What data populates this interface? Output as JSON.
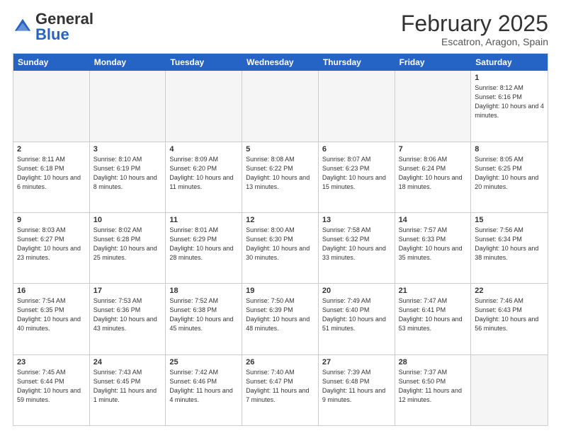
{
  "header": {
    "logo": {
      "general": "General",
      "blue": "Blue"
    },
    "month_title": "February 2025",
    "location": "Escatron, Aragon, Spain"
  },
  "calendar": {
    "days_of_week": [
      "Sunday",
      "Monday",
      "Tuesday",
      "Wednesday",
      "Thursday",
      "Friday",
      "Saturday"
    ],
    "weeks": [
      [
        {
          "day": "",
          "info": ""
        },
        {
          "day": "",
          "info": ""
        },
        {
          "day": "",
          "info": ""
        },
        {
          "day": "",
          "info": ""
        },
        {
          "day": "",
          "info": ""
        },
        {
          "day": "",
          "info": ""
        },
        {
          "day": "1",
          "info": "Sunrise: 8:12 AM\nSunset: 6:16 PM\nDaylight: 10 hours and 4 minutes."
        }
      ],
      [
        {
          "day": "2",
          "info": "Sunrise: 8:11 AM\nSunset: 6:18 PM\nDaylight: 10 hours and 6 minutes."
        },
        {
          "day": "3",
          "info": "Sunrise: 8:10 AM\nSunset: 6:19 PM\nDaylight: 10 hours and 8 minutes."
        },
        {
          "day": "4",
          "info": "Sunrise: 8:09 AM\nSunset: 6:20 PM\nDaylight: 10 hours and 11 minutes."
        },
        {
          "day": "5",
          "info": "Sunrise: 8:08 AM\nSunset: 6:22 PM\nDaylight: 10 hours and 13 minutes."
        },
        {
          "day": "6",
          "info": "Sunrise: 8:07 AM\nSunset: 6:23 PM\nDaylight: 10 hours and 15 minutes."
        },
        {
          "day": "7",
          "info": "Sunrise: 8:06 AM\nSunset: 6:24 PM\nDaylight: 10 hours and 18 minutes."
        },
        {
          "day": "8",
          "info": "Sunrise: 8:05 AM\nSunset: 6:25 PM\nDaylight: 10 hours and 20 minutes."
        }
      ],
      [
        {
          "day": "9",
          "info": "Sunrise: 8:03 AM\nSunset: 6:27 PM\nDaylight: 10 hours and 23 minutes."
        },
        {
          "day": "10",
          "info": "Sunrise: 8:02 AM\nSunset: 6:28 PM\nDaylight: 10 hours and 25 minutes."
        },
        {
          "day": "11",
          "info": "Sunrise: 8:01 AM\nSunset: 6:29 PM\nDaylight: 10 hours and 28 minutes."
        },
        {
          "day": "12",
          "info": "Sunrise: 8:00 AM\nSunset: 6:30 PM\nDaylight: 10 hours and 30 minutes."
        },
        {
          "day": "13",
          "info": "Sunrise: 7:58 AM\nSunset: 6:32 PM\nDaylight: 10 hours and 33 minutes."
        },
        {
          "day": "14",
          "info": "Sunrise: 7:57 AM\nSunset: 6:33 PM\nDaylight: 10 hours and 35 minutes."
        },
        {
          "day": "15",
          "info": "Sunrise: 7:56 AM\nSunset: 6:34 PM\nDaylight: 10 hours and 38 minutes."
        }
      ],
      [
        {
          "day": "16",
          "info": "Sunrise: 7:54 AM\nSunset: 6:35 PM\nDaylight: 10 hours and 40 minutes."
        },
        {
          "day": "17",
          "info": "Sunrise: 7:53 AM\nSunset: 6:36 PM\nDaylight: 10 hours and 43 minutes."
        },
        {
          "day": "18",
          "info": "Sunrise: 7:52 AM\nSunset: 6:38 PM\nDaylight: 10 hours and 45 minutes."
        },
        {
          "day": "19",
          "info": "Sunrise: 7:50 AM\nSunset: 6:39 PM\nDaylight: 10 hours and 48 minutes."
        },
        {
          "day": "20",
          "info": "Sunrise: 7:49 AM\nSunset: 6:40 PM\nDaylight: 10 hours and 51 minutes."
        },
        {
          "day": "21",
          "info": "Sunrise: 7:47 AM\nSunset: 6:41 PM\nDaylight: 10 hours and 53 minutes."
        },
        {
          "day": "22",
          "info": "Sunrise: 7:46 AM\nSunset: 6:43 PM\nDaylight: 10 hours and 56 minutes."
        }
      ],
      [
        {
          "day": "23",
          "info": "Sunrise: 7:45 AM\nSunset: 6:44 PM\nDaylight: 10 hours and 59 minutes."
        },
        {
          "day": "24",
          "info": "Sunrise: 7:43 AM\nSunset: 6:45 PM\nDaylight: 11 hours and 1 minute."
        },
        {
          "day": "25",
          "info": "Sunrise: 7:42 AM\nSunset: 6:46 PM\nDaylight: 11 hours and 4 minutes."
        },
        {
          "day": "26",
          "info": "Sunrise: 7:40 AM\nSunset: 6:47 PM\nDaylight: 11 hours and 7 minutes."
        },
        {
          "day": "27",
          "info": "Sunrise: 7:39 AM\nSunset: 6:48 PM\nDaylight: 11 hours and 9 minutes."
        },
        {
          "day": "28",
          "info": "Sunrise: 7:37 AM\nSunset: 6:50 PM\nDaylight: 11 hours and 12 minutes."
        },
        {
          "day": "",
          "info": ""
        }
      ]
    ]
  }
}
